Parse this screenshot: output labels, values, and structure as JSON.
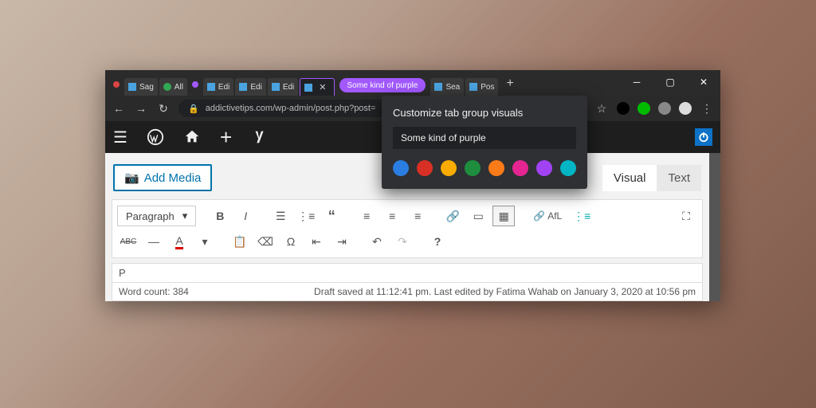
{
  "tabs": [
    {
      "label": "Sag",
      "favicon": "blue"
    },
    {
      "label": "All",
      "favicon": "green-circle"
    },
    {
      "label": "Edi",
      "favicon": "blue"
    },
    {
      "label": "Edi",
      "favicon": "blue"
    },
    {
      "label": "Edi",
      "favicon": "blue"
    },
    {
      "label": "",
      "favicon": "blue",
      "active": true
    }
  ],
  "group_pill": "Some kind of purple",
  "after_tabs": [
    {
      "label": "Sea",
      "favicon": "blue"
    },
    {
      "label": "Pos",
      "favicon": "blue"
    }
  ],
  "url": "addictivetips.com/wp-admin/post.php?post=",
  "popup": {
    "title": "Customize tab group visuals",
    "input_value": "Some kind of purple",
    "colors": [
      "#2a7de1",
      "#d93025",
      "#f9ab00",
      "#1e8e3e",
      "#fa7b17",
      "#e52592",
      "#a142f4",
      "#01b5c4"
    ]
  },
  "add_media_label": "Add Media",
  "view_tabs": {
    "visual": "Visual",
    "text": "Text"
  },
  "format_selector": "Paragraph",
  "afl_label": "AfL",
  "path_crumb": "P",
  "status": {
    "wordcount": "Word count: 384",
    "draft": "Draft saved at 11:12:41 pm. Last edited by Fatima Wahab on January 3, 2020 at 10:56 pm"
  }
}
